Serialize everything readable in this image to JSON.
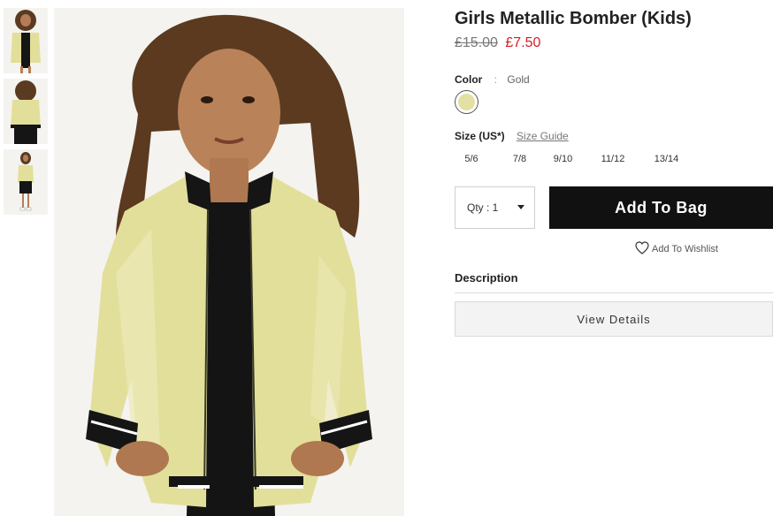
{
  "product": {
    "title": "Girls Metallic Bomber (Kids)",
    "price_original": "£15.00",
    "price_sale": "£7.50"
  },
  "color": {
    "label": "Color",
    "separator": ":",
    "value": "Gold",
    "swatch_hex": "#e2e0a3"
  },
  "size": {
    "label": "Size (US*)",
    "guide_link": "Size Guide",
    "options": [
      "5/6",
      "7/8",
      "9/10",
      "11/12",
      "13/14"
    ]
  },
  "qty": {
    "label": "Qty : 1"
  },
  "actions": {
    "add_to_bag": "Add To Bag",
    "wishlist": "Add To Wishlist"
  },
  "description": {
    "label": "Description",
    "view_details": "View Details"
  },
  "colors": {
    "sale_price": "#d21f26",
    "button_bg": "#111111",
    "jacket": "#e2df9a"
  },
  "icons": {
    "wishlist": "heart-icon",
    "qty": "caret-down-icon"
  }
}
